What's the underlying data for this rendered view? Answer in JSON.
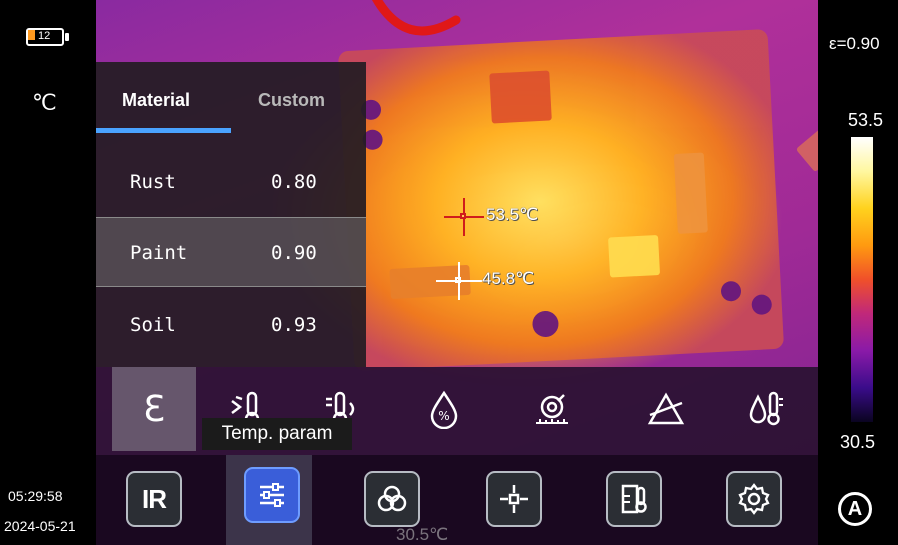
{
  "status": {
    "battery_level": "12",
    "unit": "℃",
    "time": "05:29:58",
    "date": "2024-05-21"
  },
  "scale": {
    "emissivity": "ε=0.90",
    "max": "53.5",
    "min": "30.5"
  },
  "spots": {
    "hot": "53.5℃",
    "center": "45.8℃",
    "cold_partial": "30.5℃"
  },
  "panel": {
    "tabs": [
      "Material",
      "Custom"
    ],
    "active_tab": "Material",
    "materials": [
      {
        "name": "Rust",
        "value": "0.80"
      },
      {
        "name": "Paint",
        "value": "0.90"
      },
      {
        "name": "Soil",
        "value": "0.93"
      }
    ],
    "selected_index": 1
  },
  "toolbar": {
    "emissivity_glyph": "ℇ",
    "tooltip": "Temp. param",
    "tools": [
      "emissivity-icon",
      "reflected-temp-icon",
      "ambient-temp-icon",
      "humidity-icon",
      "distance-icon",
      "transmittance-icon",
      "temp-correction-icon"
    ]
  },
  "bottom_nav": {
    "ir_label": "IR",
    "items": [
      "ir-mode-button",
      "parameters-button",
      "palette-button",
      "measure-tool-button",
      "alarm-button",
      "settings-button"
    ],
    "selected": "parameters-button",
    "auto_label": "A"
  },
  "colors": {
    "accent": "#4aa3ff",
    "nav_selected": "#3a5ed9",
    "hot_cross": "#d01c1c",
    "battery": "#ff9a1f"
  }
}
